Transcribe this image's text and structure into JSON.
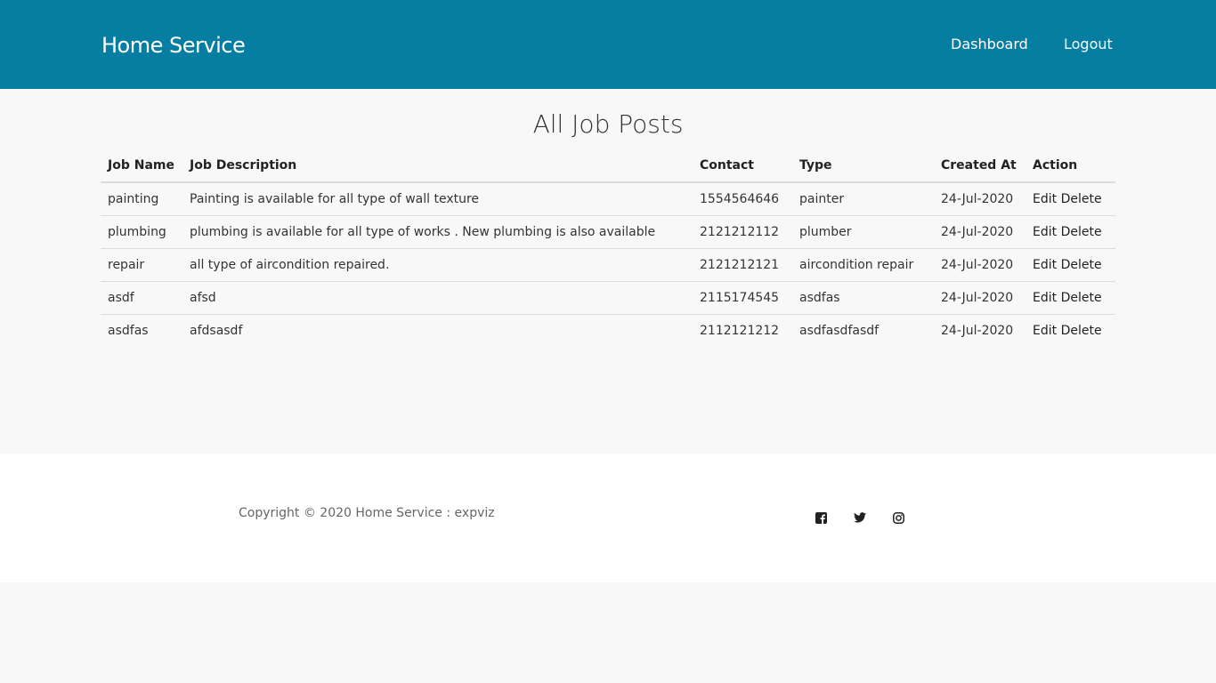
{
  "header": {
    "brand": "Home Service",
    "nav": {
      "dashboard": "Dashboard",
      "logout": "Logout"
    },
    "background_color": "#067ea2"
  },
  "main": {
    "title": "All Job Posts",
    "table": {
      "columns": [
        "Job Name",
        "Job Description",
        "Contact",
        "Type",
        "Created At",
        "Action"
      ],
      "rows": [
        {
          "name": "painting",
          "description": "Painting is available for all type of wall texture",
          "contact": "1554564646",
          "type": "painter",
          "created": "24-Jul-2020",
          "edit": "Edit",
          "delete": "Delete"
        },
        {
          "name": "plumbing",
          "description": "plumbing is available for all type of works . New plumbing is also available",
          "contact": "2121212112",
          "type": "plumber",
          "created": "24-Jul-2020",
          "edit": "Edit",
          "delete": "Delete"
        },
        {
          "name": "repair",
          "description": "all type of aircondition repaired.",
          "contact": "2121212121",
          "type": "aircondition repair",
          "created": "24-Jul-2020",
          "edit": "Edit",
          "delete": "Delete"
        },
        {
          "name": "asdf",
          "description": "afsd",
          "contact": "2115174545",
          "type": "asdfas",
          "created": "24-Jul-2020",
          "edit": "Edit",
          "delete": "Delete"
        },
        {
          "name": "asdfas",
          "description": "afdsasdf",
          "contact": "2112121212",
          "type": "asdfasdfasdf",
          "created": "24-Jul-2020",
          "edit": "Edit",
          "delete": "Delete"
        }
      ]
    }
  },
  "footer": {
    "copyright": "Copyright © 2020 Home Service : expviz",
    "social_icons": [
      "facebook-icon",
      "twitter-icon",
      "instagram-icon"
    ]
  }
}
